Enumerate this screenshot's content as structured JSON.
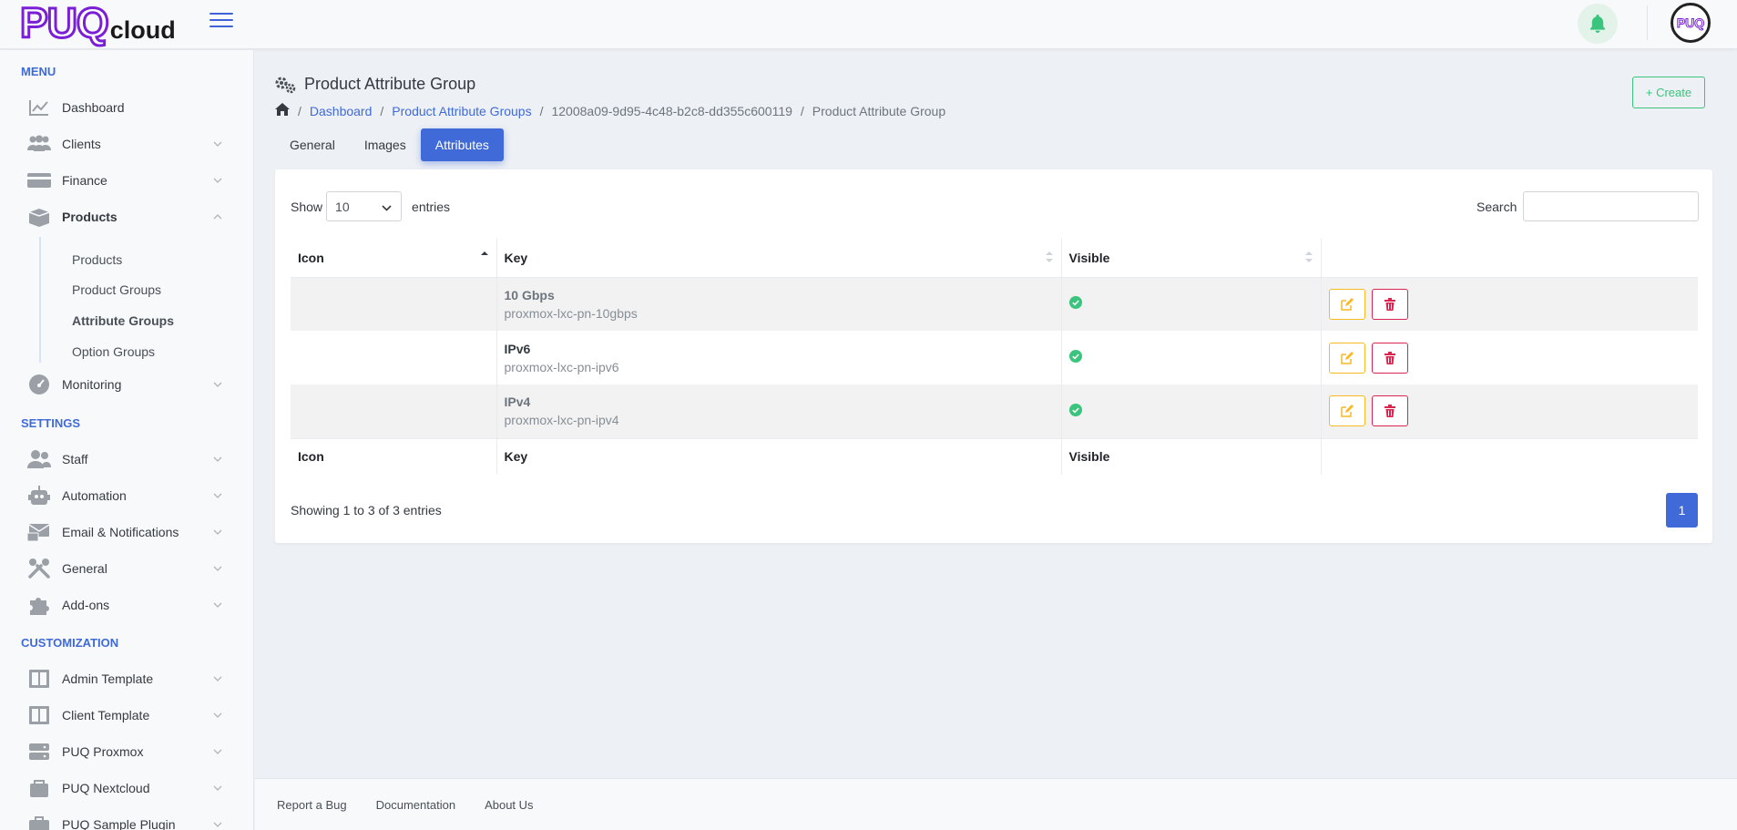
{
  "brand": {
    "logo_main": "PUQ",
    "logo_sub": "cloud",
    "avatar_text": "PUQ"
  },
  "colors": {
    "accent": "#3f6ad8",
    "success": "#3ac47d",
    "warning": "#f7b924",
    "danger": "#d92550",
    "logo": "#7b1fd6"
  },
  "sidebar": {
    "menu_title": "MENU",
    "settings_title": "SETTINGS",
    "customization_title": "CUSTOMIZATION",
    "items": [
      {
        "label": "Dashboard",
        "icon": "chart-line-icon"
      },
      {
        "label": "Clients",
        "icon": "users-icon"
      },
      {
        "label": "Finance",
        "icon": "credit-card-icon"
      },
      {
        "label": "Products",
        "icon": "box-icon"
      },
      {
        "label": "Monitoring",
        "icon": "gauge-icon"
      },
      {
        "label": "Staff",
        "icon": "user-group-icon"
      },
      {
        "label": "Automation",
        "icon": "robot-icon"
      },
      {
        "label": "Email & Notifications",
        "icon": "envelope-icon"
      },
      {
        "label": "General",
        "icon": "tools-icon"
      },
      {
        "label": "Add-ons",
        "icon": "puzzle-icon"
      },
      {
        "label": "Admin Template",
        "icon": "layout-icon"
      },
      {
        "label": "Client Template",
        "icon": "layout-icon"
      },
      {
        "label": "PUQ Proxmox",
        "icon": "server-icon"
      },
      {
        "label": "PUQ Nextcloud",
        "icon": "cloud-box-icon"
      },
      {
        "label": "PUQ Sample Plugin",
        "icon": "briefcase-icon"
      }
    ],
    "product_subitems": [
      "Products",
      "Product Groups",
      "Attribute Groups",
      "Option Groups"
    ]
  },
  "page": {
    "title": "Product Attribute Group",
    "create_label": "+ Create",
    "breadcrumb": [
      "Dashboard",
      "Product Attribute Groups",
      "12008a09-9d95-4c48-b2c8-dd355c600119",
      "Product Attribute Group"
    ],
    "tabs": [
      "General",
      "Images",
      "Attributes"
    ],
    "active_tab": "Attributes"
  },
  "table": {
    "show_label": "Show",
    "entries_label": "entries",
    "page_size": "10",
    "search_label": "Search",
    "search_value": "",
    "columns": [
      "Icon",
      "Key",
      "Visible",
      ""
    ],
    "rows": [
      {
        "name": "10 Gbps",
        "key": "proxmox-lxc-pn-10gbps",
        "visible": true
      },
      {
        "name": "IPv6",
        "key": "proxmox-lxc-pn-ipv6",
        "visible": true
      },
      {
        "name": "IPv4",
        "key": "proxmox-lxc-pn-ipv4",
        "visible": true
      }
    ],
    "showing_text": "Showing 1 to 3 of 3 entries",
    "current_page": "1"
  },
  "footer": {
    "links": [
      "Report a Bug",
      "Documentation",
      "About Us"
    ]
  }
}
